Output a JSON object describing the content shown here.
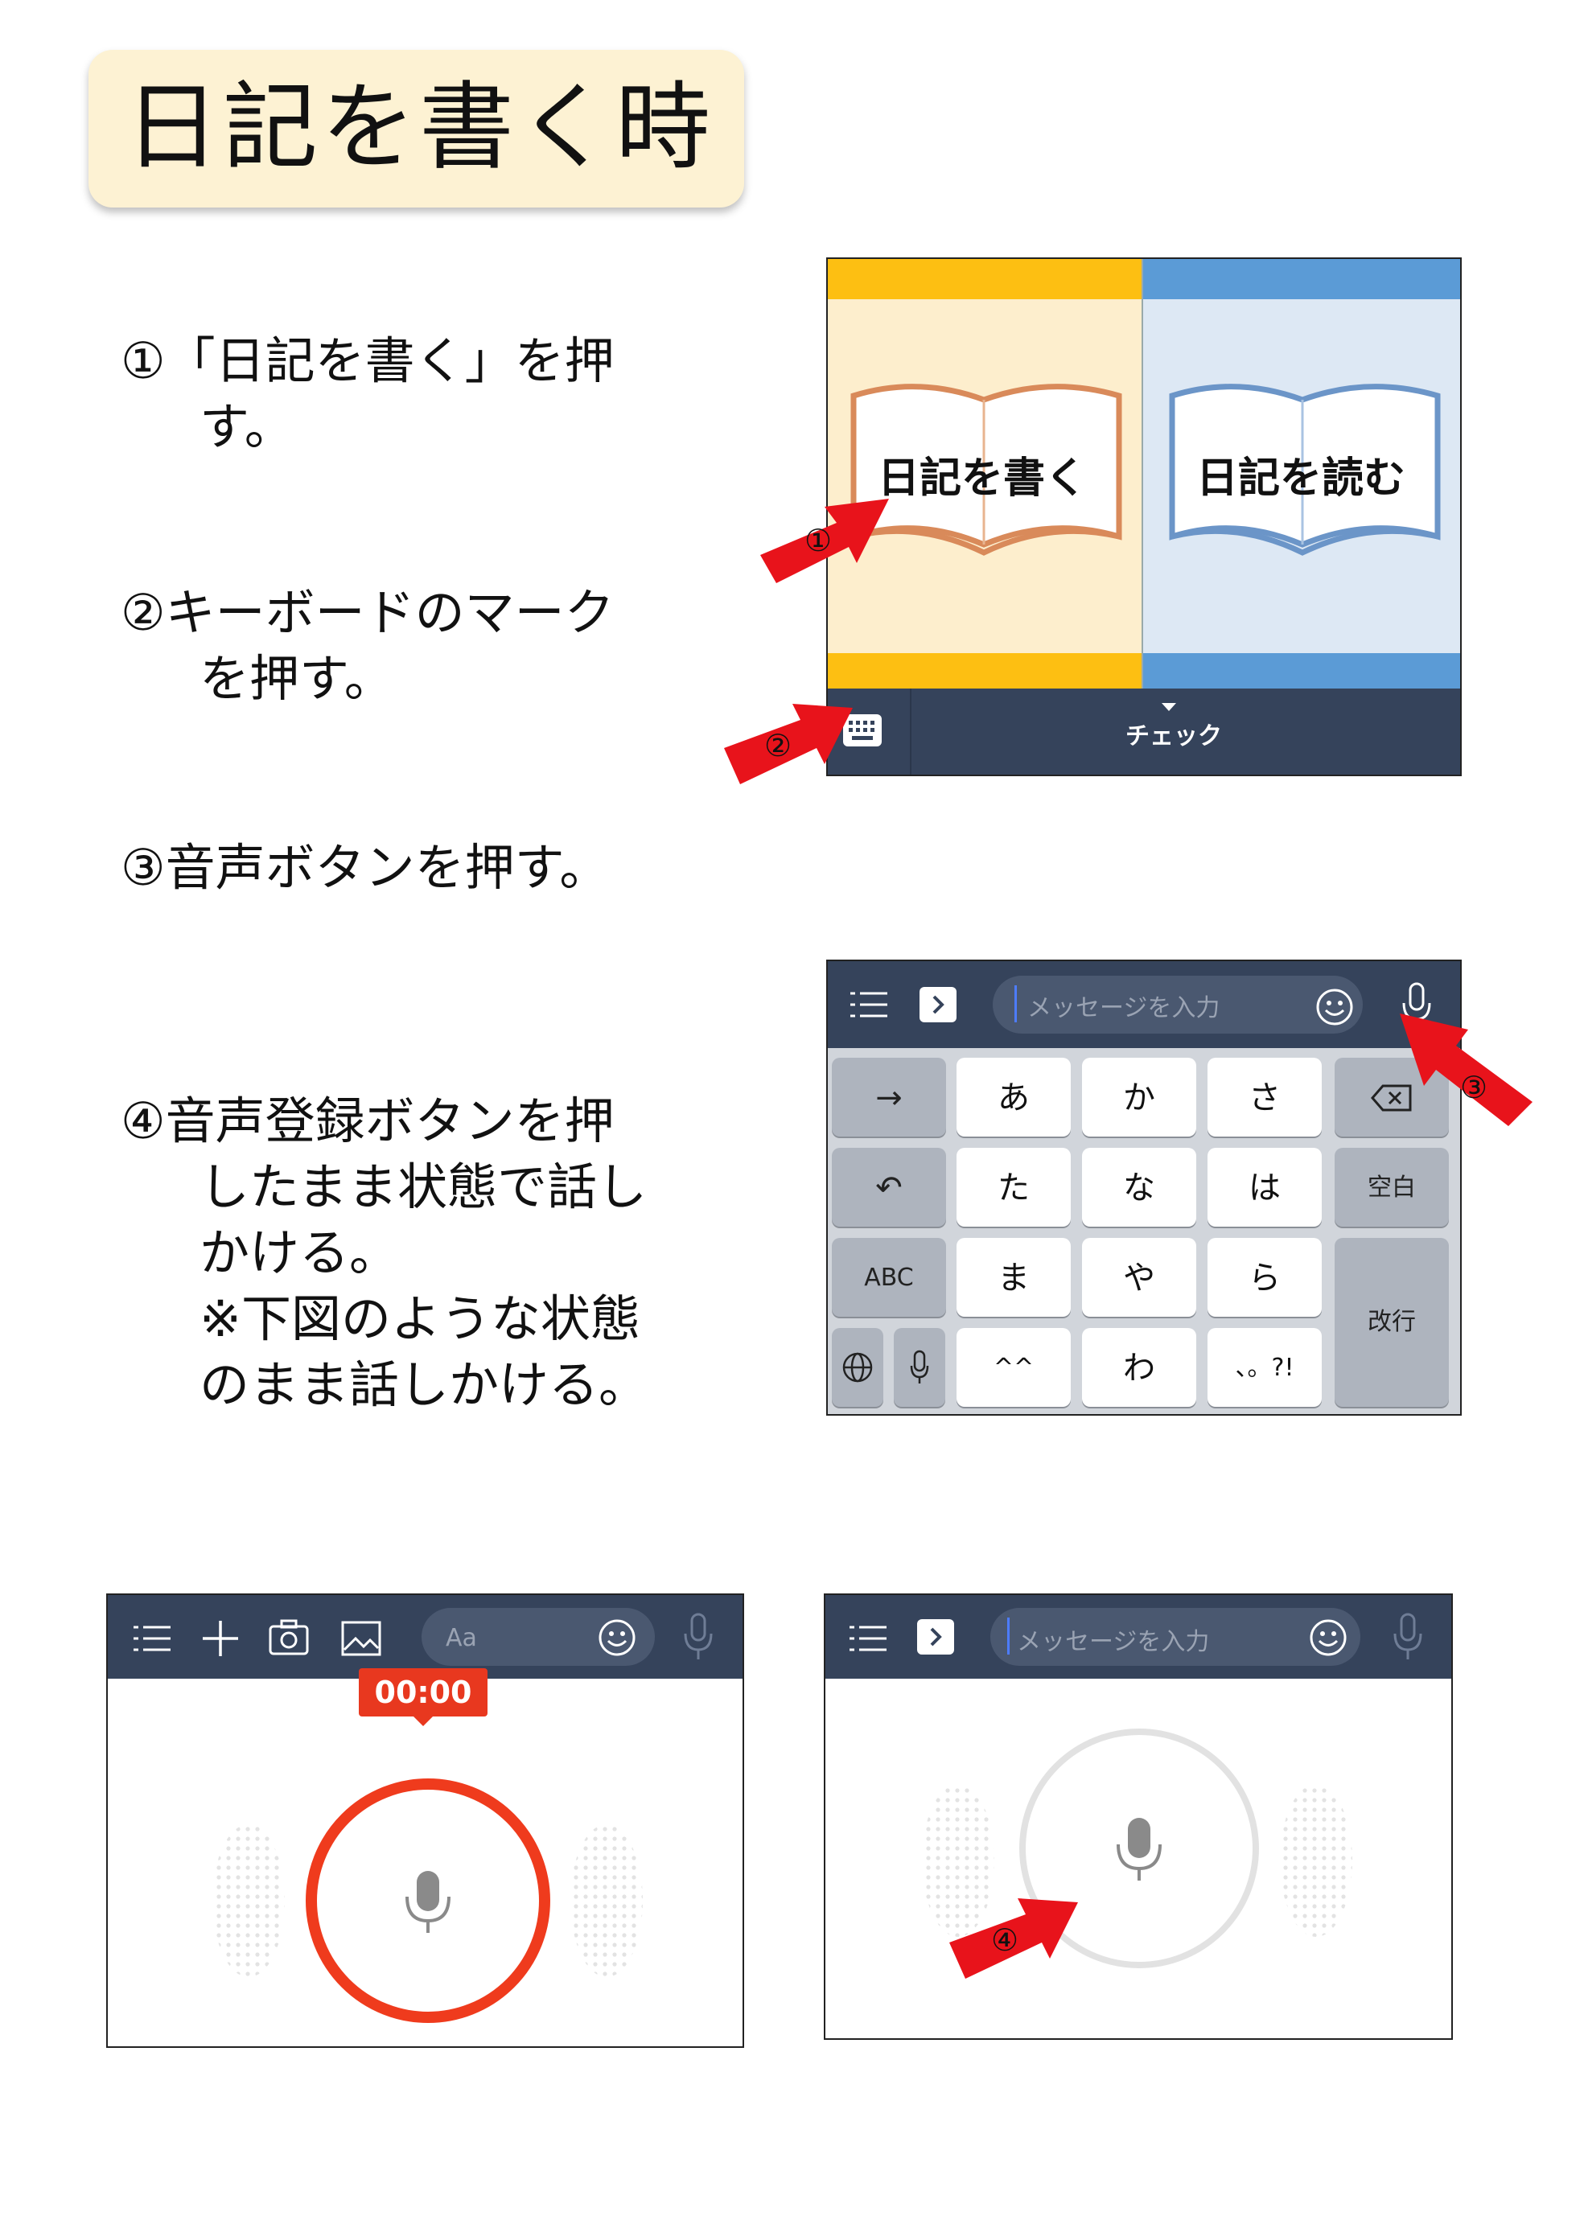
{
  "title": "日記を書く時",
  "steps": {
    "s1_line1": "①「日記を書く」を押",
    "s1_line2": "す。",
    "s2_line1": "②キーボードのマーク",
    "s2_line2": "を押す。",
    "s3_line1": "③音声ボタンを押す。",
    "s4_line1": "④音声登録ボタンを押",
    "s4_line2": "したまま状態で話し",
    "s4_line3": "かける。",
    "s4_line4": "※下図のような状態",
    "s4_line5": "のまま話しかける。"
  },
  "home_screen": {
    "write_diary": "日記を書く",
    "read_diary": "日記を読む",
    "check_label": "チェック",
    "marker1": "①",
    "marker2": "②"
  },
  "keyboard_screen": {
    "message_placeholder": "メッセージを入力",
    "marker3": "③",
    "keys": {
      "arrow": "→",
      "a": "あ",
      "ka": "か",
      "sa": "さ",
      "undo": "↶",
      "ta": "た",
      "na": "な",
      "ha": "は",
      "space": "空白",
      "abc": "ABC",
      "ma": "ま",
      "ya": "や",
      "ra": "ら",
      "enter": "改行",
      "kaomoji": "^^",
      "wa": "わ",
      "punct": "、。?!"
    }
  },
  "recording_screen": {
    "input_placeholder": "Aa",
    "timer": "00:00"
  },
  "voice_screen": {
    "message_placeholder": "メッセージを入力",
    "marker4": "④"
  },
  "colors": {
    "navbar": "#35435b",
    "yellow": "#fdbf12",
    "blue": "#5b9bd6",
    "record_red": "#e8381f",
    "arrow_red": "#e8131b"
  }
}
